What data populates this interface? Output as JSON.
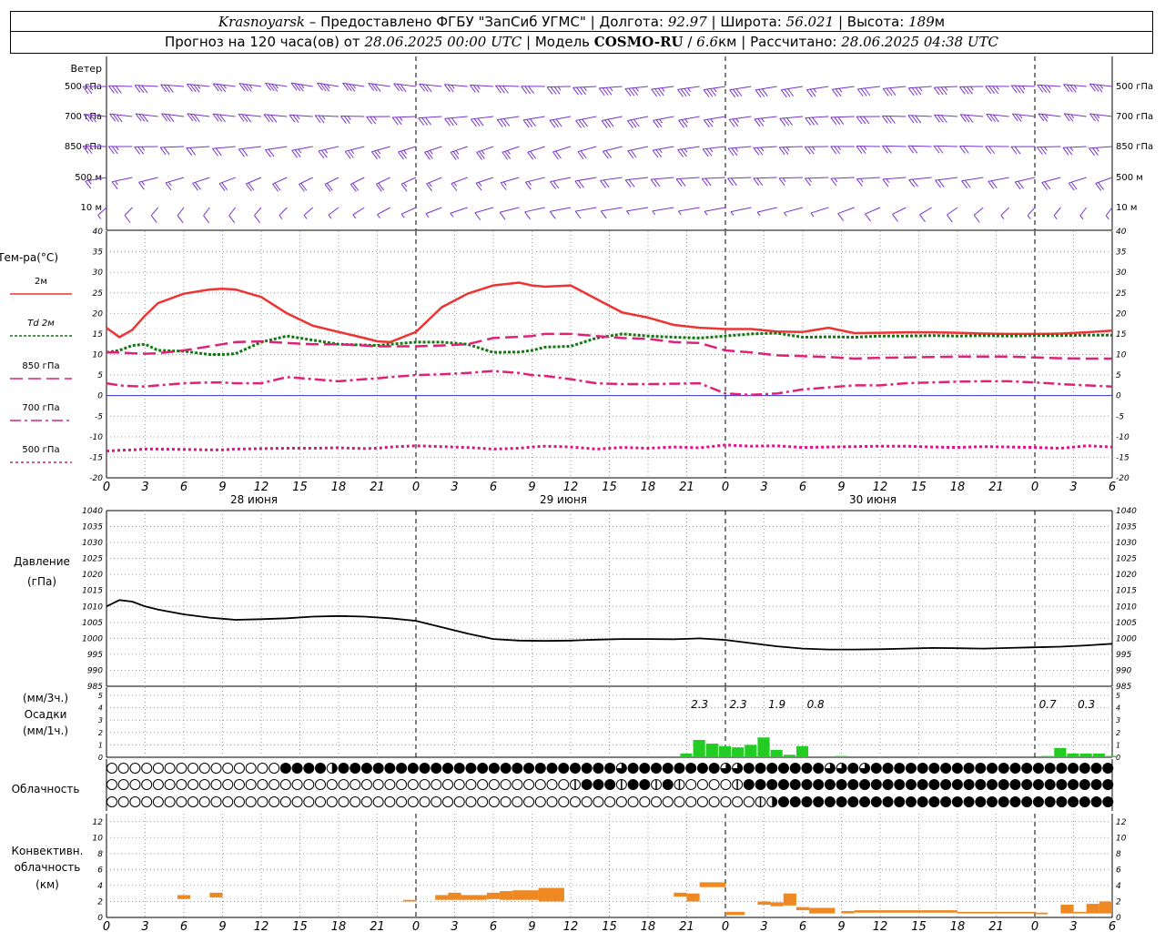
{
  "header": {
    "station": "Krasnoyarsk",
    "dash": "–",
    "provider": "Предоставлено ФГБУ \"ЗапСиб УГМС\"",
    "lon_label": "Долгота:",
    "lon": "92.97",
    "lat_label": "Широта:",
    "lat": "56.021",
    "alt_label": "Высота:",
    "alt": "189",
    "alt_unit": "м",
    "forecast_prefix": "Прогноз на 120 часа(ов) от",
    "forecast_start": "28.06.2025 00:00 UTC",
    "model_label": "Модель",
    "model": "COSMO-RU",
    "resolution": "6.6",
    "res_unit": "км",
    "calc_label": "Рассчитано:",
    "calc_time": "28.06.2025 04:38 UTC",
    "sep": "|",
    "slash": "/"
  },
  "labels": {
    "wind": "Ветер",
    "wind_levels": [
      "500 гПа",
      "700 гПа",
      "850 гПа",
      "500 м",
      "10 м"
    ],
    "temp_title": "Тем-ра(°C)",
    "temp_legend": [
      "2м",
      "Td 2м",
      "850 гПа",
      "700 гПа",
      "500 гПа"
    ],
    "pressure_title": "Давление",
    "pressure_unit": "(гПа)",
    "precip_unit_top": "(мм/3ч.)",
    "precip_title": "Осадки",
    "precip_unit_bottom": "(мм/1ч.)",
    "cloud_title": "Облачность",
    "conv_title_1": "Конвективн.",
    "conv_title_2": "облачность",
    "conv_unit": "(км)"
  },
  "colors": {
    "t2m": "#ee3333",
    "td2m": "#117711",
    "t850": "#dd2277",
    "t700": "#dd2277",
    "t500": "#dd1188",
    "pressure": "#000000",
    "precip": "#22cc22",
    "convective": "#ee8822",
    "wind": "#7733cc",
    "grid": "#999999",
    "zero_line": "#3333dd"
  },
  "x_axis": {
    "hour_ticks": [
      "0",
      "3",
      "6",
      "9",
      "12",
      "15",
      "18",
      "21",
      "0",
      "3",
      "6",
      "9",
      "12",
      "15",
      "18",
      "21",
      "0",
      "3",
      "6",
      "9",
      "12",
      "15",
      "18",
      "21",
      "0",
      "3",
      "6"
    ],
    "days": [
      "28 июня",
      "29 июня",
      "30 июня"
    ]
  },
  "chart_data": [
    {
      "type": "line",
      "title": "Тем-ра(°C)",
      "x_hours": [
        0,
        1,
        2,
        3,
        4,
        6,
        8,
        9,
        10,
        12,
        14,
        16,
        18,
        20,
        21,
        22,
        24,
        26,
        28,
        30,
        32,
        33,
        34,
        36,
        38,
        40,
        42,
        44,
        46,
        48,
        50,
        52,
        54,
        56,
        58,
        60,
        62,
        64,
        66,
        68,
        70,
        72,
        74,
        76,
        78
      ],
      "ylim": [
        -20,
        40
      ],
      "yticks": [
        -20,
        -15,
        -10,
        -5,
        0,
        5,
        10,
        15,
        20,
        25,
        30,
        35,
        40
      ],
      "series": [
        {
          "name": "2м",
          "values": [
            16.5,
            14.2,
            16,
            19.5,
            22.5,
            24.8,
            25.8,
            26,
            25.8,
            24,
            20,
            17,
            15.5,
            14,
            13.2,
            13,
            15.5,
            21.5,
            24.8,
            26.8,
            27.5,
            26.8,
            26.5,
            26.8,
            23.5,
            20.2,
            19,
            17.2,
            16.5,
            16.2,
            16.2,
            15.6,
            15.5,
            16.5,
            15.2,
            15.3,
            15.4,
            15.4,
            15.3,
            15.1,
            15,
            15,
            15.1,
            15.4,
            15.8
          ]
        },
        {
          "name": "Td 2м",
          "values": [
            10.5,
            11,
            12.2,
            12.5,
            11,
            10.8,
            10,
            10,
            10.2,
            13,
            14.5,
            13.5,
            12.5,
            12.3,
            12.2,
            12.5,
            13,
            13,
            12.5,
            10.5,
            10.6,
            11,
            11.8,
            12,
            14,
            15,
            14.5,
            14.2,
            14,
            14.5,
            15,
            15.2,
            14.2,
            14.3,
            14.2,
            14.5,
            14.5,
            14.6,
            14.5,
            14.6,
            14.5,
            14.6,
            14.6,
            14.7,
            14.7
          ]
        },
        {
          "name": "850 гПа",
          "values": [
            10.5,
            10.5,
            10.3,
            10.2,
            10.3,
            11,
            12,
            12.5,
            13,
            13.2,
            12.8,
            12.5,
            12.5,
            12.2,
            12,
            12,
            12,
            12.2,
            12.5,
            14,
            14.3,
            14.5,
            15,
            15,
            14.5,
            14,
            13.8,
            13,
            12.8,
            11,
            10.5,
            9.8,
            9.6,
            9.4,
            9,
            9.2,
            9.3,
            9.4,
            9.5,
            9.5,
            9.5,
            9.3,
            9.1,
            9,
            9
          ]
        },
        {
          "name": "700 гПа",
          "values": [
            3,
            2.5,
            2.3,
            2.2,
            2.5,
            3,
            3.2,
            3.2,
            3,
            3,
            4.5,
            4,
            3.5,
            4,
            4.2,
            4.5,
            5,
            5.2,
            5.5,
            6,
            5.5,
            5,
            4.8,
            4,
            3,
            2.8,
            2.8,
            2.9,
            3,
            0.5,
            0.2,
            0.5,
            1.5,
            2,
            2.5,
            2.5,
            3,
            3.2,
            3.4,
            3.5,
            3.5,
            3.2,
            2.8,
            2.5,
            2.2
          ]
        },
        {
          "name": "500 гПа",
          "values": [
            -13.5,
            -13.3,
            -13.2,
            -13,
            -13,
            -13.1,
            -13.2,
            -13.2,
            -13,
            -12.9,
            -12.8,
            -12.8,
            -12.7,
            -12.9,
            -12.8,
            -12.5,
            -12.2,
            -12.4,
            -12.6,
            -13,
            -12.8,
            -12.5,
            -12.3,
            -12.5,
            -13,
            -12.6,
            -12.8,
            -12.5,
            -12.7,
            -12,
            -12.3,
            -12.2,
            -12.6,
            -12.5,
            -12.4,
            -12.3,
            -12.3,
            -12.5,
            -12.6,
            -12.4,
            -12.5,
            -12.6,
            -12.8,
            -12.2,
            -12.5
          ]
        }
      ]
    },
    {
      "type": "line",
      "title": "Давление",
      "ylabel": "(гПа)",
      "x_hours": [
        0,
        1,
        2,
        3,
        4,
        6,
        8,
        10,
        12,
        14,
        16,
        18,
        20,
        22,
        24,
        26,
        28,
        30,
        32,
        34,
        36,
        38,
        40,
        42,
        44,
        46,
        48,
        50,
        52,
        54,
        56,
        58,
        60,
        62,
        64,
        66,
        68,
        70,
        72,
        74,
        76,
        78
      ],
      "ylim": [
        985,
        1040
      ],
      "yticks": [
        985,
        990,
        995,
        1000,
        1005,
        1010,
        1015,
        1020,
        1025,
        1030,
        1035,
        1040
      ],
      "series": [
        {
          "name": "Давление",
          "values": [
            1010,
            1012,
            1011.5,
            1010,
            1009,
            1007.5,
            1006.5,
            1005.8,
            1006,
            1006.3,
            1006.8,
            1007,
            1006.8,
            1006.3,
            1005.5,
            1003.5,
            1001.5,
            999.8,
            999.3,
            999.2,
            999.3,
            999.6,
            999.8,
            999.8,
            999.7,
            1000,
            999.5,
            998.5,
            997.5,
            996.8,
            996.5,
            996.5,
            996.6,
            996.8,
            997,
            996.9,
            996.8,
            997,
            997.2,
            997.4,
            997.8,
            998.3
          ]
        }
      ]
    },
    {
      "type": "bar",
      "title": "Осадки",
      "ylabel": "(мм/1ч.)",
      "x_hours": [
        45,
        46,
        47,
        48,
        49,
        50,
        51,
        52,
        53,
        54,
        55,
        56,
        57,
        73,
        74,
        75,
        76,
        77,
        78
      ],
      "values": [
        0.3,
        1.4,
        1.1,
        0.9,
        0.8,
        1,
        1.6,
        0.6,
        0.2,
        0.9,
        0,
        0,
        0.1,
        0.1,
        0.75,
        0.3,
        0.3,
        0.3,
        0.1
      ],
      "ylim": [
        0,
        5
      ],
      "yticks": [
        0,
        1,
        2,
        3,
        4,
        5
      ],
      "annotations": [
        {
          "x_hour": 46,
          "label": "2.3"
        },
        {
          "x_hour": 49,
          "label": "2.3"
        },
        {
          "x_hour": 52,
          "label": "1.9"
        },
        {
          "x_hour": 55,
          "label": "0.8"
        },
        {
          "x_hour": 73,
          "label": "0.7"
        },
        {
          "x_hour": 76,
          "label": "0.3"
        }
      ]
    },
    {
      "type": "bar",
      "title": "Конвективн. облачность",
      "ylabel": "(км)",
      "ylim": [
        0,
        13
      ],
      "yticks": [
        0,
        2,
        4,
        6,
        8,
        10,
        12
      ],
      "bars": [
        {
          "x0": 5.5,
          "x1": 6.5,
          "bottom": 2.3,
          "top": 2.8
        },
        {
          "x0": 8,
          "x1": 9,
          "bottom": 2.5,
          "top": 3.1
        },
        {
          "x0": 23,
          "x1": 24,
          "bottom": 2.0,
          "top": 2.2
        },
        {
          "x0": 25.5,
          "x1": 26.5,
          "bottom": 2.2,
          "top": 2.8
        },
        {
          "x0": 26.5,
          "x1": 27.5,
          "bottom": 2.2,
          "top": 3.1
        },
        {
          "x0": 27.5,
          "x1": 29.5,
          "bottom": 2.2,
          "top": 2.8
        },
        {
          "x0": 29.5,
          "x1": 30.5,
          "bottom": 2.3,
          "top": 3.1
        },
        {
          "x0": 30.5,
          "x1": 31.5,
          "bottom": 2.2,
          "top": 3.3
        },
        {
          "x0": 31.5,
          "x1": 33.5,
          "bottom": 2.2,
          "top": 3.4
        },
        {
          "x0": 33.5,
          "x1": 35.5,
          "bottom": 2.0,
          "top": 3.7
        },
        {
          "x0": 44,
          "x1": 45,
          "bottom": 2.6,
          "top": 3.1
        },
        {
          "x0": 45,
          "x1": 46,
          "bottom": 2.0,
          "top": 3.0
        },
        {
          "x0": 46,
          "x1": 48,
          "bottom": 3.8,
          "top": 4.4
        },
        {
          "x0": 48,
          "x1": 49.5,
          "bottom": 0.3,
          "top": 0.7
        },
        {
          "x0": 50.5,
          "x1": 51.5,
          "bottom": 1.6,
          "top": 2.0
        },
        {
          "x0": 51.5,
          "x1": 52.5,
          "bottom": 1.4,
          "top": 1.9
        },
        {
          "x0": 52.5,
          "x1": 53.5,
          "bottom": 1.5,
          "top": 3.0
        },
        {
          "x0": 53.5,
          "x1": 54.5,
          "bottom": 0.9,
          "top": 1.3
        },
        {
          "x0": 54.5,
          "x1": 56.5,
          "bottom": 0.5,
          "top": 1.2
        },
        {
          "x0": 57,
          "x1": 58,
          "bottom": 0.5,
          "top": 0.8
        },
        {
          "x0": 58,
          "x1": 66,
          "bottom": 0.6,
          "top": 0.9
        },
        {
          "x0": 66,
          "x1": 72,
          "bottom": 0.5,
          "top": 0.7
        },
        {
          "x0": 72,
          "x1": 73,
          "bottom": 0.4,
          "top": 0.6
        },
        {
          "x0": 74,
          "x1": 75,
          "bottom": 0.5,
          "top": 1.6
        },
        {
          "x0": 75,
          "x1": 76,
          "bottom": 0.5,
          "top": 0.7
        },
        {
          "x0": 76,
          "x1": 77,
          "bottom": 0.5,
          "top": 1.7
        },
        {
          "x0": 77,
          "x1": 78,
          "bottom": 0.5,
          "top": 2.0
        }
      ]
    }
  ],
  "cloud_rows": {
    "low": "000000000000000333323333333333333333333333334333333334433333334434333333333333333333333",
    "mid": "000000000000000000000000000000000000000013331331310000133333333333333333333333333333333",
    "high": "000000000000000000000000000000000000000000000000000000001233333333333333333333333333333"
  },
  "wind_levels": {
    "names": [
      "500 гПа",
      "700 гПа",
      "850 гПа",
      "500 м",
      "10 м"
    ],
    "speed_ms": [
      18,
      16,
      13,
      10,
      4
    ],
    "direction_deg": [
      270,
      265,
      250,
      240,
      220
    ]
  }
}
